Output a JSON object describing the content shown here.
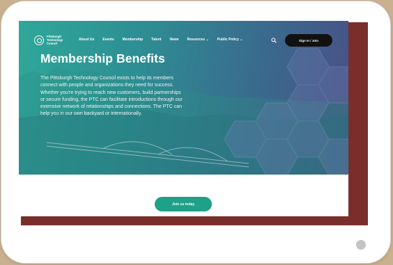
{
  "logo": {
    "text": "Pittsburgh\nTechnology\nCouncil"
  },
  "nav": {
    "items": [
      "About Us",
      "Events",
      "Membership",
      "Talent",
      "News",
      "Resources ⌄",
      "Public Policy ⌄"
    ],
    "cta_label": "Sign In / Join"
  },
  "hero": {
    "title": "Membership Benefits",
    "body": "The Pittsburgh Technology Council exists to help its members connect with people and organizations they need for success. Whether you're trying to reach new customers, build partnerships or secure funding, the PTC can facilitate introductions through our extensive network of relationships and connections. The PTC can help you in our own backyard or internationally."
  },
  "join": {
    "label": "Join us today"
  },
  "colors": {
    "accent_block": "#7a2e2b",
    "join_button": "#1fa088",
    "hero_start": "#2fa89a",
    "hero_end": "#4a4f86"
  }
}
